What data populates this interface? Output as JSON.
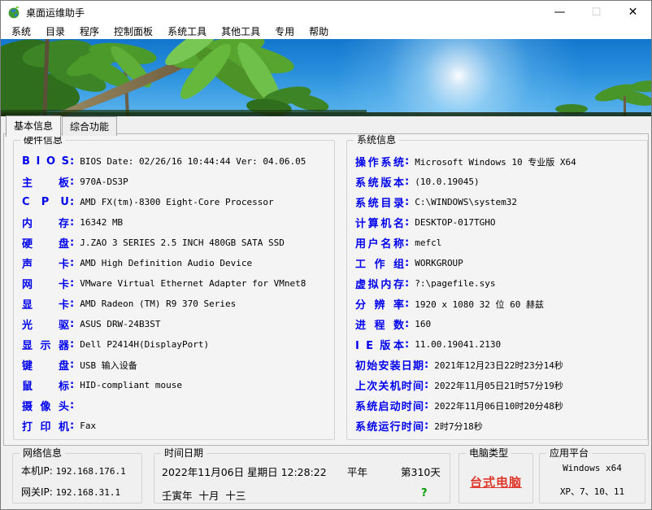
{
  "window": {
    "title": "桌面运维助手",
    "controls": {
      "minimize": "—",
      "maximize": "☐",
      "close": "✕"
    }
  },
  "menu": {
    "items": [
      "系统",
      "目录",
      "程序",
      "控制面板",
      "系统工具",
      "其他工具",
      "专用",
      "帮助"
    ]
  },
  "tabs": [
    {
      "label": "基本信息",
      "active": true
    },
    {
      "label": "综合功能",
      "active": false
    }
  ],
  "hardware": {
    "title": "硬件信息",
    "rows": [
      {
        "label": "B I O S",
        "value": "BIOS Date: 02/26/16 10:44:44 Ver: 04.06.05"
      },
      {
        "label": "主 板",
        "value": "970A-DS3P"
      },
      {
        "label": "C P U",
        "value": "AMD FX(tm)-8300 Eight-Core Processor"
      },
      {
        "label": "内 存",
        "value": "16342 MB"
      },
      {
        "label": "硬 盘",
        "value": "J.ZAO 3 SERIES 2.5 INCH 480GB SATA SSD"
      },
      {
        "label": "声 卡",
        "value": "AMD High Definition Audio Device"
      },
      {
        "label": "网 卡",
        "value": "VMware Virtual Ethernet Adapter for VMnet8"
      },
      {
        "label": "显 卡",
        "value": "AMD Radeon (TM) R9 370 Series"
      },
      {
        "label": "光 驱",
        "value": "ASUS DRW-24B3ST"
      },
      {
        "label": "显示器",
        "value": "Dell P2414H(DisplayPort)"
      },
      {
        "label": "键 盘",
        "value": "USB 输入设备"
      },
      {
        "label": "鼠 标",
        "value": "HID-compliant mouse"
      },
      {
        "label": "摄像头",
        "value": ""
      },
      {
        "label": "打印机",
        "value": "Fax"
      }
    ]
  },
  "system": {
    "title": "系统信息",
    "rows": [
      {
        "label": "操作系统",
        "value": "Microsoft Windows 10 专业版 X64"
      },
      {
        "label": "系统版本",
        "value": "(10.0.19045)"
      },
      {
        "label": "系统目录",
        "value": "C:\\WINDOWS\\system32"
      },
      {
        "label": "计算机名",
        "value": "DESKTOP-017TGHO"
      },
      {
        "label": "用户名称",
        "value": "mefcl"
      },
      {
        "label": "工 作 组",
        "value": "WORKGROUP"
      },
      {
        "label": "虚拟内存",
        "value": "?:\\pagefile.sys"
      },
      {
        "label": "分 辨 率",
        "value": "1920 x 1080 32 位 60 赫兹"
      },
      {
        "label": "进 程 数",
        "value": "160"
      },
      {
        "label": "I E 版本",
        "value": "11.00.19041.2130"
      },
      {
        "label": "初始安装日期",
        "value": "2021年12月23日22时23分14秒"
      },
      {
        "label": "上次关机时间",
        "value": "2022年11月05日21时57分19秒"
      },
      {
        "label": "系统启动时间",
        "value": "2022年11月06日10时20分48秒"
      },
      {
        "label": "系统运行时间",
        "value": "2时7分18秒"
      }
    ]
  },
  "network": {
    "title": "网络信息",
    "local_label": "本机IP:",
    "local_value": "192.168.176.1",
    "gateway_label": "网关IP:",
    "gateway_value": "192.168.31.1"
  },
  "datetime": {
    "title": "时间日期",
    "line1": "2022年11月06日 星期日 12:28:22",
    "year_type": "平年",
    "day_of_year": "第310天",
    "line2": "壬寅年  十月  十三",
    "help": "?"
  },
  "computer_type": {
    "title": "电脑类型",
    "value": "台式电脑"
  },
  "platform": {
    "title": "应用平台",
    "line1": "Windows x64",
    "line2": "XP、7、10、11"
  },
  "colors": {
    "label_blue": "#0000ee",
    "type_red": "#e0362a",
    "help_green": "#009b00",
    "sky_blue": "#2a90dd"
  }
}
